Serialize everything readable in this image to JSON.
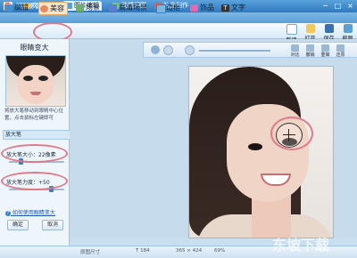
{
  "window": {
    "title": "可牛影像  v2.4.1.1002",
    "controls": [
      "─",
      "□",
      "×"
    ]
  },
  "tabs": [
    {
      "label": "图片编辑",
      "active": true
    },
    {
      "label": "动感闪图",
      "active": false
    },
    {
      "label": "礼品制作",
      "active": false
    }
  ],
  "first_tab_partial": "欢迎页",
  "toolbar": {
    "tools": [
      {
        "label": "编辑",
        "active": false
      },
      {
        "label": "美容",
        "active": true
      },
      {
        "label": "场景",
        "active": false
      },
      {
        "label": "高清场景",
        "active": false
      },
      {
        "label": "边框",
        "active": false
      },
      {
        "label": "饰品",
        "active": false
      },
      {
        "label": "文字",
        "active": false
      }
    ],
    "right_buttons": [
      "新建",
      "打开",
      "保存",
      "截图"
    ]
  },
  "edit_tools": [
    "对比",
    "撤销",
    "重做",
    "还原"
  ],
  "left_panel": {
    "title": "眼睛变大",
    "tip": "将放大笔移动到眼睛中心位置，点击鼠标左键即可",
    "section": "放大笔",
    "brush_size_label": "放大笔大小：22像素",
    "brush_size_value": 22,
    "brush_strength_label": "放大笔力度：+50",
    "brush_strength_value": 50,
    "help_link": "如何使用眼睛变大",
    "ok_button": "确定",
    "cancel_button": "取消"
  },
  "status": {
    "left": "原图尺寸",
    "mid": "T 184",
    "size": "365 × 424",
    "zoom": "69%"
  },
  "watermark": "东坡下载",
  "colors": {
    "accent": "#3a7fc1",
    "highlight_ring": "#e07a8a"
  }
}
